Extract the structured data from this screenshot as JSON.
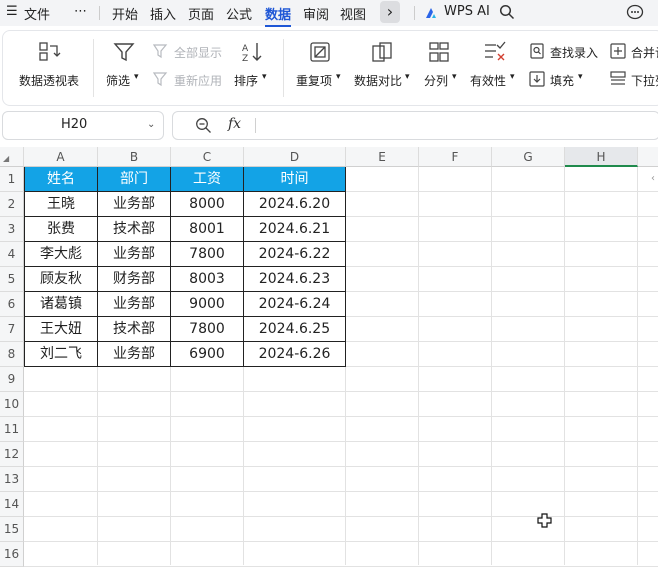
{
  "menubar": {
    "file_label": "文件",
    "more_label": "⋯",
    "tabs": [
      "开始",
      "插入",
      "页面",
      "公式",
      "数据",
      "审阅",
      "视图"
    ],
    "active_tab": "数据",
    "expand_label": "›",
    "wps_ai_label": "WPS AI"
  },
  "ribbon": {
    "pivot_table": "数据透视表",
    "filter": "筛选",
    "show_all": "全部显示",
    "reapply": "重新应用",
    "sort": "排序",
    "duplicates": "重复项",
    "compare": "数据对比",
    "split": "分列",
    "validity": "有效性",
    "lookup_entry": "查找录入",
    "fill": "填充",
    "merge": "合并计",
    "dropdown_list": "下拉列"
  },
  "formula_bar": {
    "name_box": "H20",
    "fx_label": "fx",
    "formula": ""
  },
  "sheet": {
    "columns": [
      "A",
      "B",
      "C",
      "D",
      "E",
      "F",
      "G",
      "H"
    ],
    "rows": [
      "1",
      "2",
      "3",
      "4",
      "5",
      "6",
      "7",
      "8",
      "9",
      "10",
      "11",
      "12",
      "13",
      "14",
      "15",
      "16"
    ],
    "header": [
      "姓名",
      "部门",
      "工资",
      "时间"
    ],
    "data": [
      [
        "王晓",
        "业务部",
        "8000",
        "2024.6.20"
      ],
      [
        "张费",
        "技术部",
        "8001",
        "2024.6.21"
      ],
      [
        "李大彪",
        "业务部",
        "7800",
        "2024-6.22"
      ],
      [
        "顾友秋",
        "财务部",
        "8003",
        "2024.6.23"
      ],
      [
        "诸葛镇",
        "业务部",
        "9000",
        "2024-6.24"
      ],
      [
        "王大妞",
        "技术部",
        "7800",
        "2024.6.25"
      ],
      [
        "刘二飞",
        "业务部",
        "6900",
        "2024-6.26"
      ]
    ],
    "header_fill": "#13A3E6",
    "selected_column": "H"
  }
}
